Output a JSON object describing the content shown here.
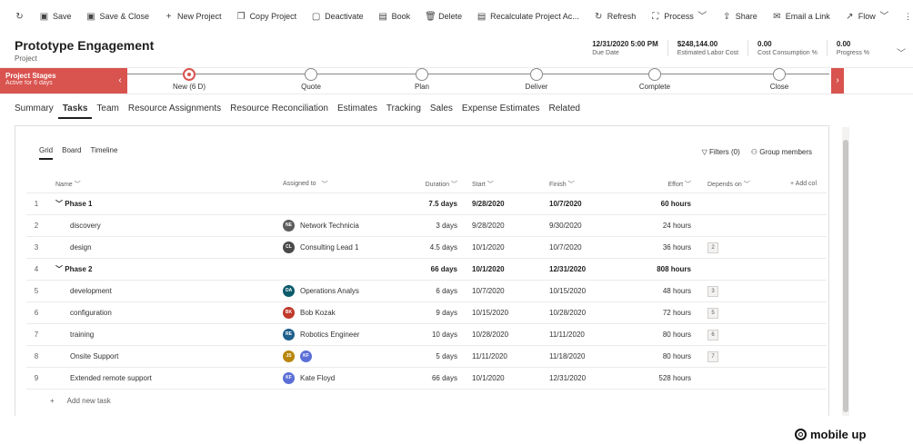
{
  "toolbar": {
    "items": [
      {
        "label": "",
        "icon": "↻"
      },
      {
        "label": "Save",
        "icon": "▣"
      },
      {
        "label": "Save & Close",
        "icon": "▣"
      },
      {
        "label": "New Project",
        "icon": "+"
      },
      {
        "label": "Copy Project",
        "icon": "❐"
      },
      {
        "label": "Deactivate",
        "icon": "▢"
      },
      {
        "label": "Book",
        "icon": "▤"
      },
      {
        "label": "Delete",
        "icon": "🗑"
      },
      {
        "label": "Recalculate Project Ac...",
        "icon": "▤"
      },
      {
        "label": "Refresh",
        "icon": "↻"
      },
      {
        "label": "Process",
        "icon": "⛶"
      },
      {
        "label": "Share",
        "icon": "⇪"
      },
      {
        "label": "Email a Link",
        "icon": "✉"
      },
      {
        "label": "Flow",
        "icon": "↗"
      }
    ],
    "more": "⋮"
  },
  "header": {
    "title": "Prototype Engagement",
    "subtitle": "Project",
    "fields": [
      {
        "value": "12/31/2020 5:00 PM",
        "label": "Due Date"
      },
      {
        "value": "$248,144.00",
        "label": "Estimated Labor Cost"
      },
      {
        "value": "0.00",
        "label": "Cost Consumption %"
      },
      {
        "value": "0.00",
        "label": "Progress %"
      }
    ]
  },
  "stagebar": {
    "active_title": "Project Stages",
    "active_sub": "Active for 6 days",
    "stages": [
      "New  (6 D)",
      "Quote",
      "Plan",
      "Deliver",
      "Complete",
      "Close"
    ],
    "active_index": 0
  },
  "tabs": [
    "Summary",
    "Tasks",
    "Team",
    "Resource Assignments",
    "Resource Reconciliation",
    "Estimates",
    "Tracking",
    "Sales",
    "Expense Estimates",
    "Related"
  ],
  "selected_tab": "Tasks",
  "views": [
    "Grid",
    "Board",
    "Timeline"
  ],
  "panel_actions": {
    "filters": "Filters (0)",
    "group": "Group members"
  },
  "grid": {
    "columns": {
      "name": "Name",
      "assigned": "Assigned to",
      "duration": "Duration",
      "start": "Start",
      "finish": "Finish",
      "effort": "Effort",
      "depends": "Depends on",
      "add": "+ Add col"
    },
    "rows": [
      {
        "num": "1",
        "type": "phase",
        "name": "Phase 1",
        "assigned": "",
        "initials": [],
        "duration": "7.5 days",
        "start": "9/28/2020",
        "finish": "10/7/2020",
        "effort": "60 hours",
        "depends": ""
      },
      {
        "num": "2",
        "type": "task",
        "name": "discovery",
        "assigned": "Network Technicia",
        "initials": [
          "NE"
        ],
        "duration": "3 days",
        "start": "9/28/2020",
        "finish": "9/30/2020",
        "effort": "24 hours",
        "depends": ""
      },
      {
        "num": "3",
        "type": "task",
        "name": "design",
        "assigned": "Consulting Lead 1",
        "initials": [
          "CL"
        ],
        "duration": "4.5 days",
        "start": "10/1/2020",
        "finish": "10/7/2020",
        "effort": "36 hours",
        "depends": "2"
      },
      {
        "num": "4",
        "type": "phase",
        "name": "Phase 2",
        "assigned": "",
        "initials": [],
        "duration": "66 days",
        "start": "10/1/2020",
        "finish": "12/31/2020",
        "effort": "808 hours",
        "depends": ""
      },
      {
        "num": "5",
        "type": "task",
        "name": "development",
        "assigned": "Operations Analys",
        "initials": [
          "OA"
        ],
        "duration": "6 days",
        "start": "10/7/2020",
        "finish": "10/15/2020",
        "effort": "48 hours",
        "depends": "3"
      },
      {
        "num": "6",
        "type": "task",
        "name": "configuration",
        "assigned": "Bob Kozak",
        "initials": [
          "BK"
        ],
        "duration": "9 days",
        "start": "10/15/2020",
        "finish": "10/28/2020",
        "effort": "72 hours",
        "depends": "5"
      },
      {
        "num": "7",
        "type": "task",
        "name": "training",
        "assigned": "Robotics Engineer",
        "initials": [
          "RE"
        ],
        "duration": "10 days",
        "start": "10/28/2020",
        "finish": "11/11/2020",
        "effort": "80 hours",
        "depends": "6"
      },
      {
        "num": "8",
        "type": "task",
        "name": "Onsite Support",
        "assigned": "",
        "initials": [
          "JS",
          "KF"
        ],
        "duration": "5 days",
        "start": "11/11/2020",
        "finish": "11/18/2020",
        "effort": "80 hours",
        "depends": "7"
      },
      {
        "num": "9",
        "type": "task",
        "name": "Extended remote support",
        "assigned": "Kate Floyd",
        "initials": [
          "KF"
        ],
        "duration": "66 days",
        "start": "10/1/2020",
        "finish": "12/31/2020",
        "effort": "528 hours",
        "depends": ""
      }
    ],
    "add_task": "Add new task"
  },
  "avatar_colors": {
    "NE": "#5c5c5c",
    "CL": "#4a4a4a",
    "OA": "#0b5a6b",
    "BK": "#c0392b",
    "RE": "#1f5f8b",
    "JS": "#b8860b",
    "KF": "#5b6fd6"
  },
  "brand": "mobile up"
}
